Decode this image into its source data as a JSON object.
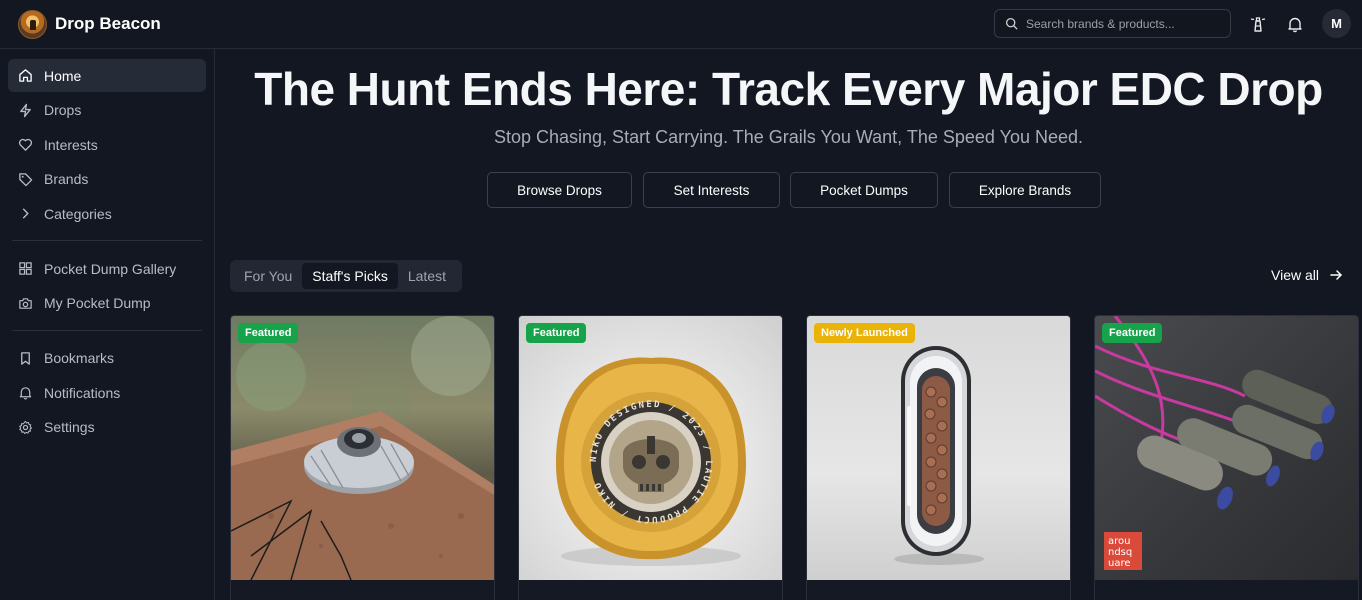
{
  "app": {
    "name": "Drop Beacon"
  },
  "search": {
    "placeholder": "Search brands & products..."
  },
  "user": {
    "initial": "M"
  },
  "sidebar": {
    "items": [
      {
        "label": "Home",
        "icon": "home-icon",
        "active": true
      },
      {
        "label": "Drops",
        "icon": "lightning-icon"
      },
      {
        "label": "Interests",
        "icon": "heart-icon"
      },
      {
        "label": "Brands",
        "icon": "tag-icon"
      },
      {
        "label": "Categories",
        "icon": "chevron-right-icon"
      },
      {
        "label": "Pocket Dump Gallery",
        "icon": "grid-icon"
      },
      {
        "label": "My Pocket Dump",
        "icon": "camera-icon"
      },
      {
        "label": "Bookmarks",
        "icon": "bookmark-icon"
      },
      {
        "label": "Notifications",
        "icon": "bell-icon"
      },
      {
        "label": "Settings",
        "icon": "gear-icon"
      }
    ]
  },
  "hero": {
    "title": "The Hunt Ends Here: Track Every Major EDC Drop",
    "subtitle": "Stop Chasing, Start Carrying. The Grails You Want, The Speed You Need.",
    "buttons": [
      "Browse Drops",
      "Set Interests",
      "Pocket Dumps",
      "Explore Brands"
    ]
  },
  "tabs": {
    "items": [
      "For You",
      "Staff's Picks",
      "Latest"
    ],
    "active": "Staff's Picks"
  },
  "view_all": "View all",
  "cards": [
    {
      "badge": "Featured",
      "badge_color": "#16a34a"
    },
    {
      "badge": "Featured",
      "badge_color": "#16a34a"
    },
    {
      "badge": "Newly Launched",
      "badge_color": "#eab308"
    },
    {
      "badge": "Featured",
      "badge_color": "#16a34a"
    }
  ],
  "card_overlays": {
    "coin_ring_text": "NIKO DESIGNED / 2025 / LAUTIE PRODUCT / NIKO",
    "watermark": [
      "arou",
      "ndsq",
      "uare"
    ]
  },
  "colors": {
    "background": "#131722",
    "active_nav": "#262b38",
    "featured": "#16a34a",
    "newly_launched": "#eab308"
  }
}
